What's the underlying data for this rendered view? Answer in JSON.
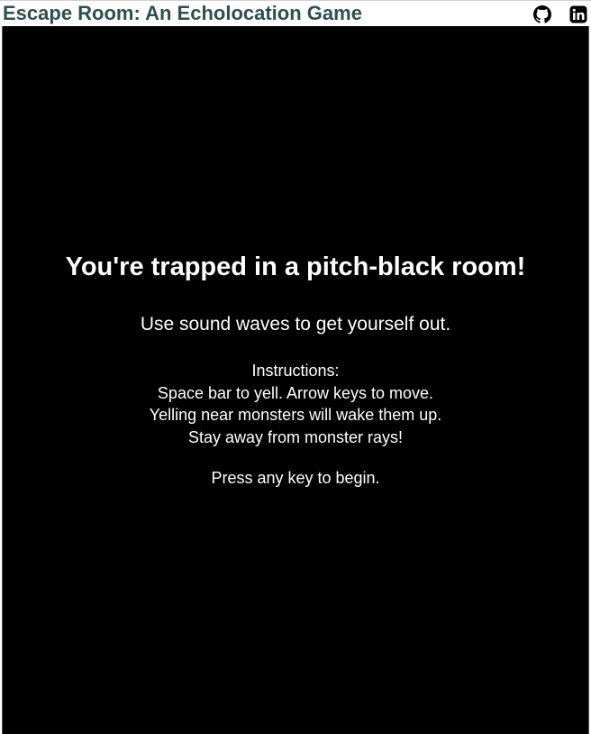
{
  "header": {
    "title": "Escape Room: An Echolocation Game",
    "title_color": "#2f4f4f",
    "icons": [
      "github-icon",
      "linkedin-icon"
    ]
  },
  "game": {
    "background": "#000000",
    "text_color": "#ffffff",
    "headline": "You're trapped in a pitch-black room!",
    "subtitle": "Use sound waves to get yourself out.",
    "instructions_heading": "Instructions:",
    "instructions": [
      "Space bar to yell. Arrow keys to move.",
      "Yelling near monsters will wake them up.",
      "Stay away from monster rays!"
    ],
    "start_prompt": "Press any key to begin."
  }
}
